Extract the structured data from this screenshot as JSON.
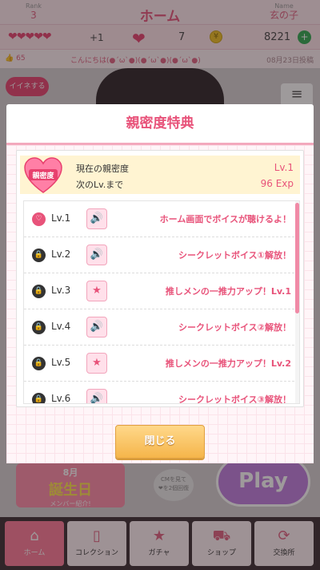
{
  "header": {
    "rank_label": "Rank",
    "rank_value": "3",
    "title": "ホーム",
    "name_label": "Name",
    "name_value": "玄の子"
  },
  "stats": {
    "hearts": "❤❤❤❤❤",
    "hearts_plus": "+1",
    "like_count": "7",
    "coins": "8221"
  },
  "message": {
    "likes": "65",
    "text": "こんにちは(●´ω`●)(●´ω`●)(●´ω`●)",
    "date": "08月23日投稿"
  },
  "home": {
    "iine_label": "イイネする",
    "bday_top": "8月",
    "bday_main": "誕生日",
    "bday_sub": "メンバー紹介!",
    "cm_text": "CMを見て\n❤を2個回復",
    "play_label": "Play"
  },
  "dialog": {
    "title": "親密度特典",
    "badge_text": "親密度",
    "current_label": "現在の親密度",
    "current_value": "Lv.1",
    "next_label": "次のLv.まで",
    "next_value": "96 Exp",
    "levels": [
      {
        "level": "Lv.1",
        "status": "unlocked",
        "type": "voice",
        "reward": "ホーム画面でボイスが聴けるよ！"
      },
      {
        "level": "Lv.2",
        "status": "locked",
        "type": "voice",
        "reward": "シークレットボイス①解放！"
      },
      {
        "level": "Lv.3",
        "status": "locked",
        "type": "card",
        "reward": "推しメンの一推力アップ！Lv.1"
      },
      {
        "level": "Lv.4",
        "status": "locked",
        "type": "voice",
        "reward": "シークレットボイス②解放！"
      },
      {
        "level": "Lv.5",
        "status": "locked",
        "type": "card",
        "reward": "推しメンの一推力アップ！Lv.2"
      },
      {
        "level": "Lv.6",
        "status": "locked",
        "type": "voice",
        "reward": "シークレットボイス③解放！"
      }
    ],
    "close_label": "閉じる"
  },
  "nav": {
    "items": [
      {
        "label": "ホーム",
        "icon": "home-icon"
      },
      {
        "label": "コレクション",
        "icon": "collection-icon"
      },
      {
        "label": "ガチャ",
        "icon": "gacha-icon"
      },
      {
        "label": "ショップ",
        "icon": "cart-icon"
      },
      {
        "label": "交換所",
        "icon": "exchange-icon"
      }
    ]
  },
  "colors": {
    "accent": "#e8537a",
    "gold": "#f5b54a",
    "header_bg": "#ffe9ee"
  }
}
